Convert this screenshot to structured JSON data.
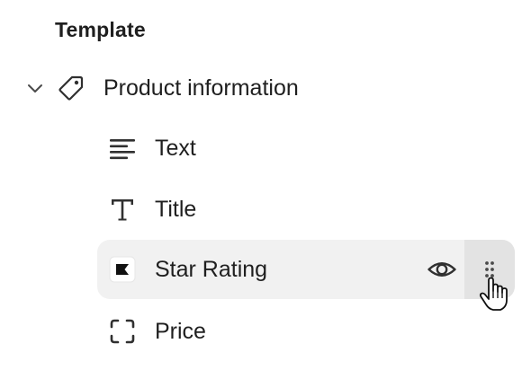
{
  "template": {
    "heading": "Template"
  },
  "group": {
    "label": "Product information",
    "expanded": true,
    "icon": "tag-icon",
    "toggle_icon": "chevron-down-icon"
  },
  "items": [
    {
      "label": "Text",
      "icon": "text-lines-icon"
    },
    {
      "label": "Title",
      "icon": "title-t-icon"
    },
    {
      "label": "Star Rating",
      "icon": "star-rating-app-icon",
      "selected": true,
      "actions": [
        "eye-icon",
        "drag-handle-icon"
      ]
    },
    {
      "label": "Price",
      "icon": "price-frame-icon"
    }
  ],
  "colors": {
    "selected_background": "#f1f1f1",
    "drag_handle_background": "#e3e3e3",
    "text": "#1f1f1f",
    "icon": "#303030"
  }
}
